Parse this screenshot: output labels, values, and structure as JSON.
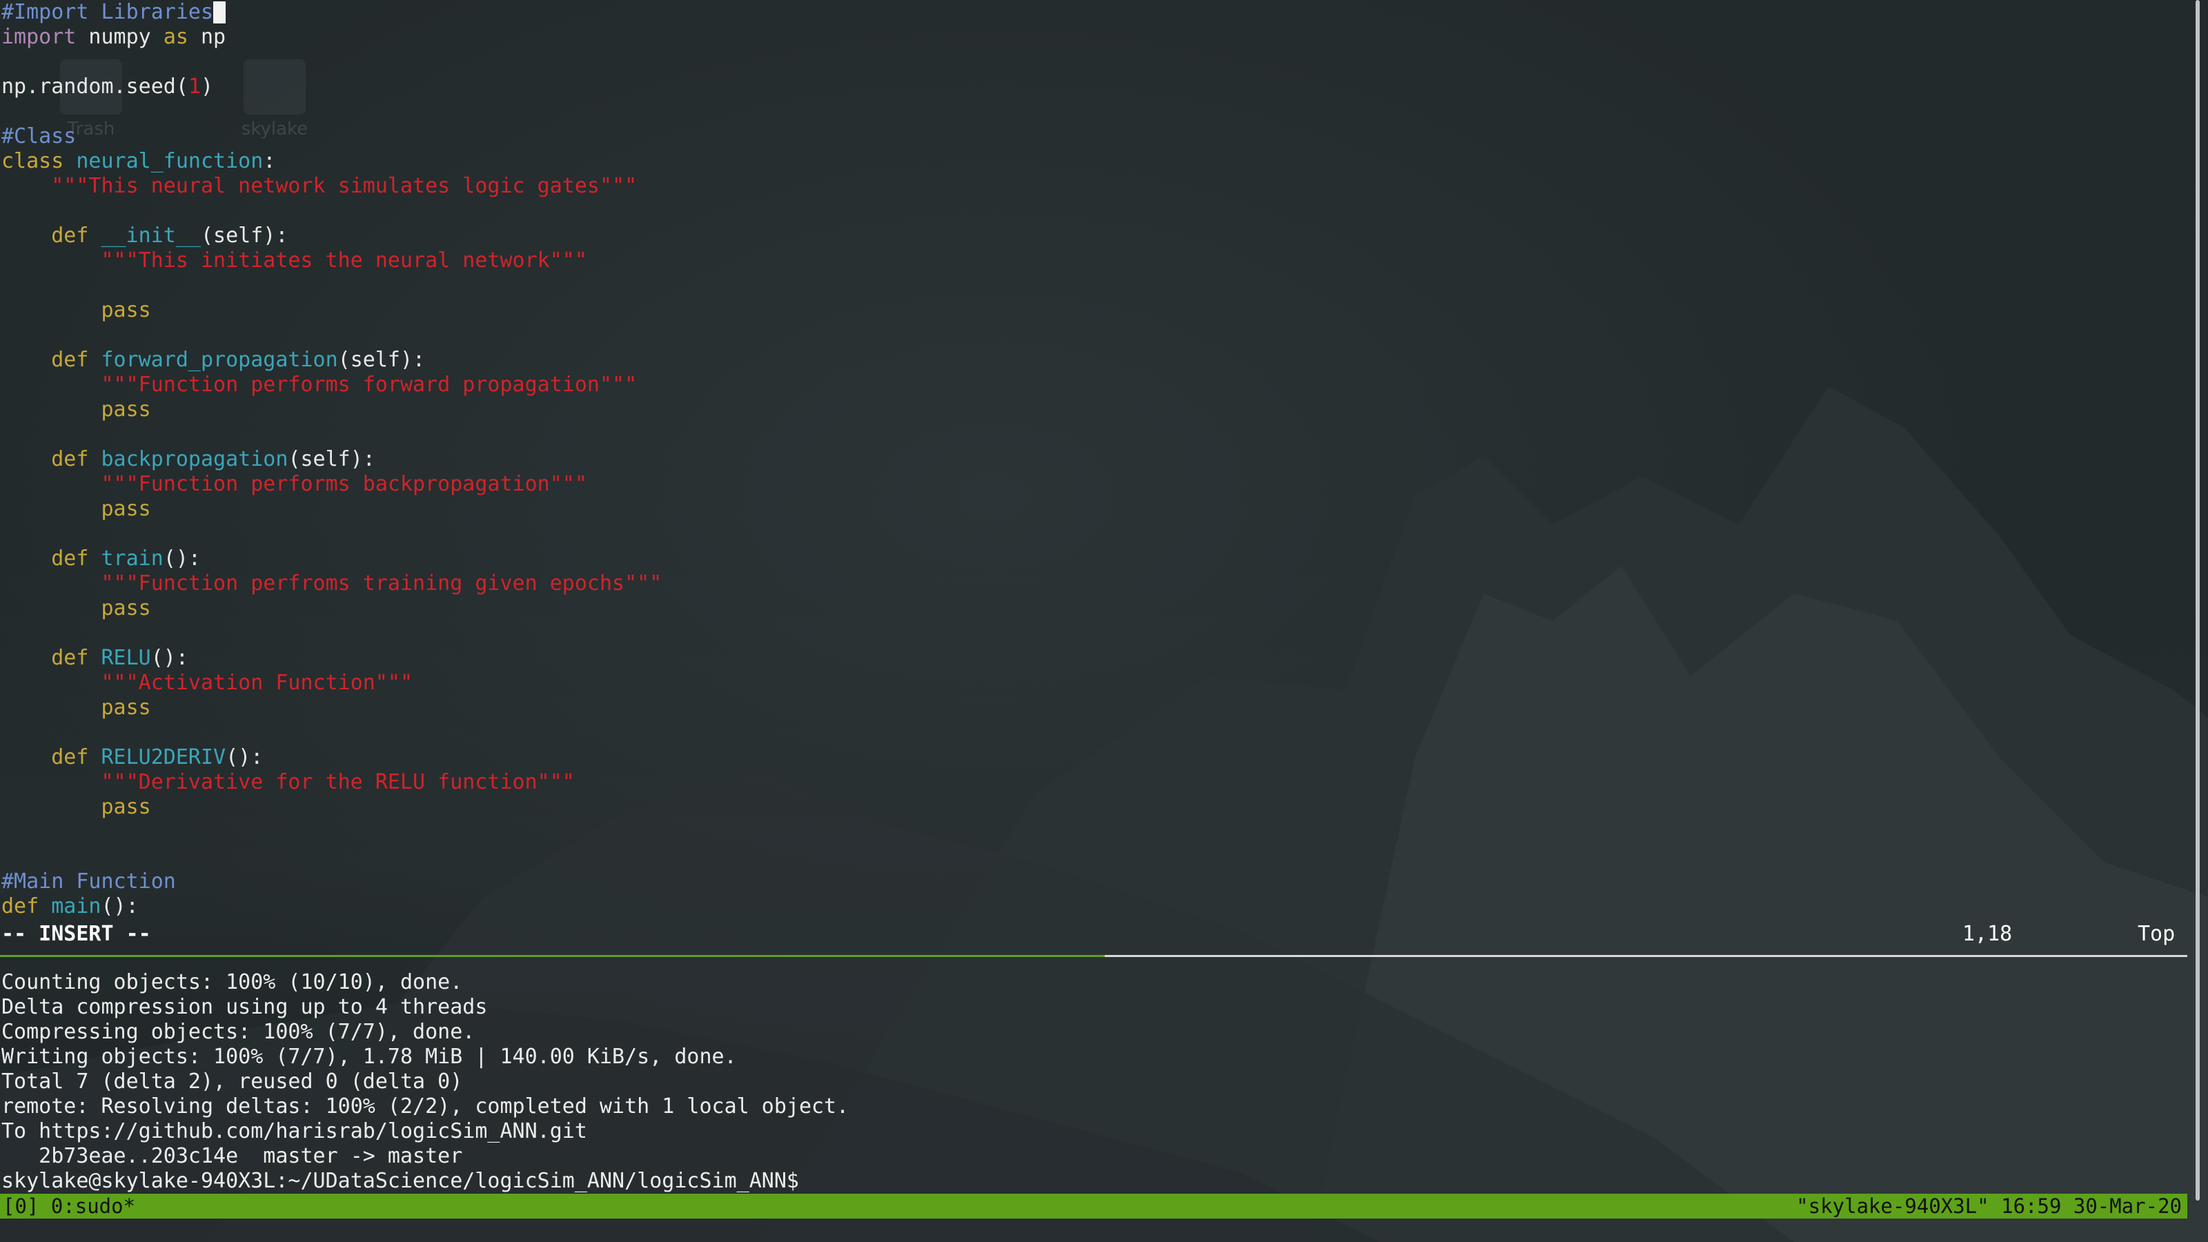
{
  "desktop": {
    "icons": [
      {
        "label": "Trash",
        "icon": "trash-icon"
      },
      {
        "label": "skylake",
        "icon": "folder-icon"
      }
    ]
  },
  "editor": {
    "lines": [
      [
        {
          "t": "#Import Libraries",
          "c": "cmt"
        }
      ],
      [
        {
          "t": "import",
          "c": "imp"
        },
        {
          "t": " numpy ",
          "c": "plain"
        },
        {
          "t": "as",
          "c": "kw"
        },
        {
          "t": " np",
          "c": "plain"
        }
      ],
      [],
      [
        {
          "t": "np.random.seed(",
          "c": "plain"
        },
        {
          "t": "1",
          "c": "num"
        },
        {
          "t": ")",
          "c": "plain"
        }
      ],
      [],
      [
        {
          "t": "#Class",
          "c": "cmt"
        }
      ],
      [
        {
          "t": "class",
          "c": "kw"
        },
        {
          "t": " ",
          "c": "plain"
        },
        {
          "t": "neural_function",
          "c": "fn"
        },
        {
          "t": ":",
          "c": "plain"
        }
      ],
      [
        {
          "t": "    ",
          "c": "plain"
        },
        {
          "t": "\"\"\"This neural network simulates logic gates\"\"\"",
          "c": "str"
        }
      ],
      [],
      [
        {
          "t": "    ",
          "c": "plain"
        },
        {
          "t": "def",
          "c": "kw"
        },
        {
          "t": " ",
          "c": "plain"
        },
        {
          "t": "__init__",
          "c": "fn"
        },
        {
          "t": "(self):",
          "c": "plain"
        }
      ],
      [
        {
          "t": "        ",
          "c": "plain"
        },
        {
          "t": "\"\"\"This initiates the neural network\"\"\"",
          "c": "str"
        }
      ],
      [],
      [
        {
          "t": "        ",
          "c": "plain"
        },
        {
          "t": "pass",
          "c": "kw"
        }
      ],
      [],
      [
        {
          "t": "    ",
          "c": "plain"
        },
        {
          "t": "def",
          "c": "kw"
        },
        {
          "t": " ",
          "c": "plain"
        },
        {
          "t": "forward_propagation",
          "c": "fn"
        },
        {
          "t": "(self):",
          "c": "plain"
        }
      ],
      [
        {
          "t": "        ",
          "c": "plain"
        },
        {
          "t": "\"\"\"Function performs forward propagation\"\"\"",
          "c": "str"
        }
      ],
      [
        {
          "t": "        ",
          "c": "plain"
        },
        {
          "t": "pass",
          "c": "kw"
        }
      ],
      [],
      [
        {
          "t": "    ",
          "c": "plain"
        },
        {
          "t": "def",
          "c": "kw"
        },
        {
          "t": " ",
          "c": "plain"
        },
        {
          "t": "backpropagation",
          "c": "fn"
        },
        {
          "t": "(self):",
          "c": "plain"
        }
      ],
      [
        {
          "t": "        ",
          "c": "plain"
        },
        {
          "t": "\"\"\"Function performs backpropagation\"\"\"",
          "c": "str"
        }
      ],
      [
        {
          "t": "        ",
          "c": "plain"
        },
        {
          "t": "pass",
          "c": "kw"
        }
      ],
      [],
      [
        {
          "t": "    ",
          "c": "plain"
        },
        {
          "t": "def",
          "c": "kw"
        },
        {
          "t": " ",
          "c": "plain"
        },
        {
          "t": "train",
          "c": "fn"
        },
        {
          "t": "():",
          "c": "plain"
        }
      ],
      [
        {
          "t": "        ",
          "c": "plain"
        },
        {
          "t": "\"\"\"Function perfroms training given epochs\"\"\"",
          "c": "str"
        }
      ],
      [
        {
          "t": "        ",
          "c": "plain"
        },
        {
          "t": "pass",
          "c": "kw"
        }
      ],
      [],
      [
        {
          "t": "    ",
          "c": "plain"
        },
        {
          "t": "def",
          "c": "kw"
        },
        {
          "t": " ",
          "c": "plain"
        },
        {
          "t": "RELU",
          "c": "fn"
        },
        {
          "t": "():",
          "c": "plain"
        }
      ],
      [
        {
          "t": "        ",
          "c": "plain"
        },
        {
          "t": "\"\"\"Activation Function\"\"\"",
          "c": "str"
        }
      ],
      [
        {
          "t": "        ",
          "c": "plain"
        },
        {
          "t": "pass",
          "c": "kw"
        }
      ],
      [],
      [
        {
          "t": "    ",
          "c": "plain"
        },
        {
          "t": "def",
          "c": "kw"
        },
        {
          "t": " ",
          "c": "plain"
        },
        {
          "t": "RELU2DERIV",
          "c": "fn"
        },
        {
          "t": "():",
          "c": "plain"
        }
      ],
      [
        {
          "t": "        ",
          "c": "plain"
        },
        {
          "t": "\"\"\"Derivative for the RELU function\"\"\"",
          "c": "str"
        }
      ],
      [
        {
          "t": "        ",
          "c": "plain"
        },
        {
          "t": "pass",
          "c": "kw"
        }
      ],
      [],
      [],
      [
        {
          "t": "#Main Function",
          "c": "cmt"
        }
      ],
      [
        {
          "t": "def",
          "c": "kw"
        },
        {
          "t": " ",
          "c": "plain"
        },
        {
          "t": "main",
          "c": "fn"
        },
        {
          "t": "():",
          "c": "plain"
        }
      ]
    ],
    "status": {
      "mode": "-- INSERT --",
      "position": "1,18",
      "scroll": "Top"
    }
  },
  "terminal": {
    "lines": [
      "Counting objects: 100% (10/10), done.",
      "Delta compression using up to 4 threads",
      "Compressing objects: 100% (7/7), done.",
      "Writing objects: 100% (7/7), 1.78 MiB | 140.00 KiB/s, done.",
      "Total 7 (delta 2), reused 0 (delta 0)",
      "remote: Resolving deltas: 100% (2/2), completed with 1 local object.",
      "To https://github.com/harisrab/logicSim_ANN.git",
      "   2b73eae..203c14e  master -> master",
      "skylake@skylake-940X3L:~/UDataScience/logicSim_ANN/logicSim_ANN$"
    ]
  },
  "tmux": {
    "left": "[0] 0:sudo*",
    "right": "\"skylake-940X3L\" 16:59 30-Mar-20"
  },
  "colors": {
    "keyword": "#c7a83a",
    "comment": "#6f8fcf",
    "function": "#3aa6b9",
    "string": "#d2232a",
    "statusbar": "#5ea21a"
  }
}
